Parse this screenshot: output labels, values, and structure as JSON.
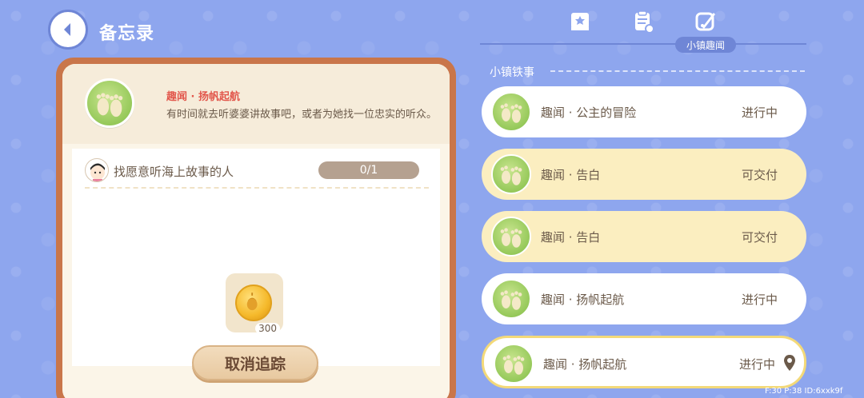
{
  "header": {
    "title": "备忘录"
  },
  "tabs": {
    "active_label": "小镇趣闻",
    "icons": [
      "book-icon",
      "clipboard-icon",
      "quill-icon"
    ]
  },
  "quest_detail": {
    "name": "趣闻 · 扬帆起航",
    "description": "有时间就去听婆婆讲故事吧，或者为她找一位忠实的听众。",
    "task": {
      "text": "找愿意听海上故事的人",
      "progress": "0/1"
    },
    "reward": {
      "icon": "acorn-coin-icon",
      "count": "300"
    },
    "cancel_label": "取消追踪"
  },
  "section": {
    "label": "小镇铁事"
  },
  "quest_list": [
    {
      "name": "趣闻 · 公主的冒险",
      "status": "进行中",
      "style": "white"
    },
    {
      "name": "趣闻 · 告白",
      "status": "可交付",
      "style": "yellow"
    },
    {
      "name": "趣闻 · 告白",
      "status": "可交付",
      "style": "yellow"
    },
    {
      "name": "趣闻 · 扬帆起航",
      "status": "进行中",
      "style": "white"
    },
    {
      "name": "趣闻 · 扬帆起航",
      "status": "进行中",
      "style": "white",
      "selected": true
    }
  ],
  "debug": {
    "text": "F:30 P:38 ID:6xxk9f"
  },
  "colors": {
    "background": "#8ea6ee",
    "accent": "#6f86d6",
    "panel_border": "#c9764a",
    "quest_title": "#e2574c"
  }
}
